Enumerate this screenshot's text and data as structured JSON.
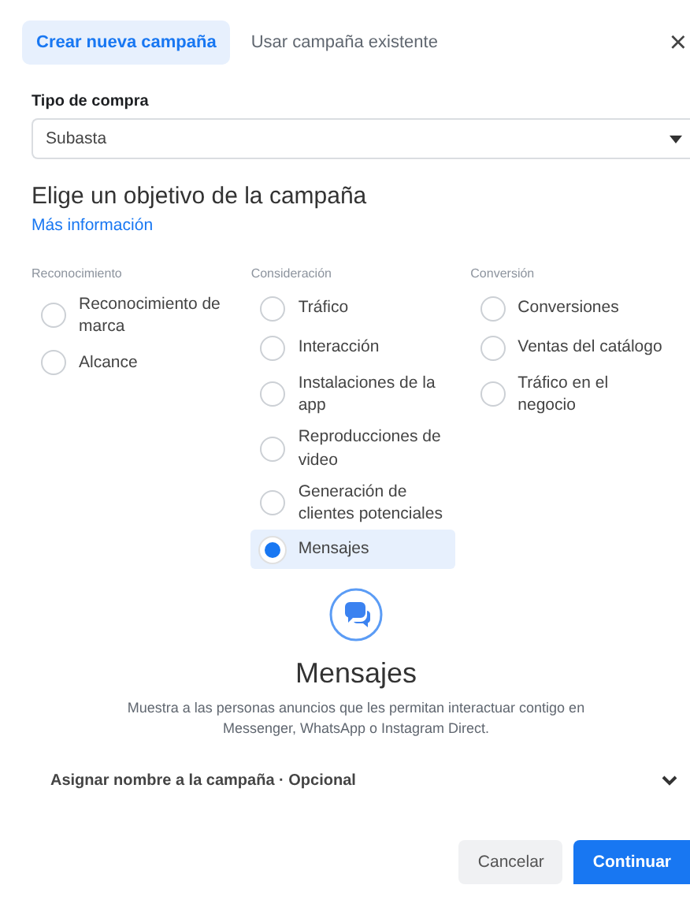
{
  "tabs": [
    {
      "label": "Crear nueva campaña",
      "selected": true
    },
    {
      "label": "Usar campaña existente",
      "selected": false
    }
  ],
  "close": "×",
  "purchase_type": {
    "label": "Tipo de compra",
    "value": "Subasta"
  },
  "objective": {
    "title": "Elige un objetivo de la campaña",
    "link": "Más información"
  },
  "columns": [
    {
      "heading": "Reconocimiento",
      "options": [
        {
          "label": "Reconocimiento de marca",
          "selected": false
        },
        {
          "label": "Alcance",
          "selected": false
        }
      ]
    },
    {
      "heading": "Consideración",
      "options": [
        {
          "label": "Tráfico",
          "selected": false
        },
        {
          "label": "Interacción",
          "selected": false
        },
        {
          "label": "Instalaciones de la app",
          "selected": false
        },
        {
          "label": "Reproducciones de video",
          "selected": false
        },
        {
          "label": "Generación de clientes potenciales",
          "selected": false
        },
        {
          "label": "Mensajes",
          "selected": true
        }
      ]
    },
    {
      "heading": "Conversión",
      "options": [
        {
          "label": "Conversiones",
          "selected": false
        },
        {
          "label": "Ventas del catálogo",
          "selected": false
        },
        {
          "label": "Tráfico en el negocio",
          "selected": false
        }
      ]
    }
  ],
  "detail": {
    "title": "Mensajes",
    "description": "Muestra a las personas anuncios que les permitan interactuar contigo en Messenger, WhatsApp o Instagram Direct."
  },
  "name_section": {
    "label": "Asignar nombre a la campaña · Opcional",
    "expanded": false
  },
  "buttons": [
    {
      "label": "Cancelar",
      "kind": "secondary"
    },
    {
      "label": "Continuar",
      "kind": "primary"
    }
  ]
}
